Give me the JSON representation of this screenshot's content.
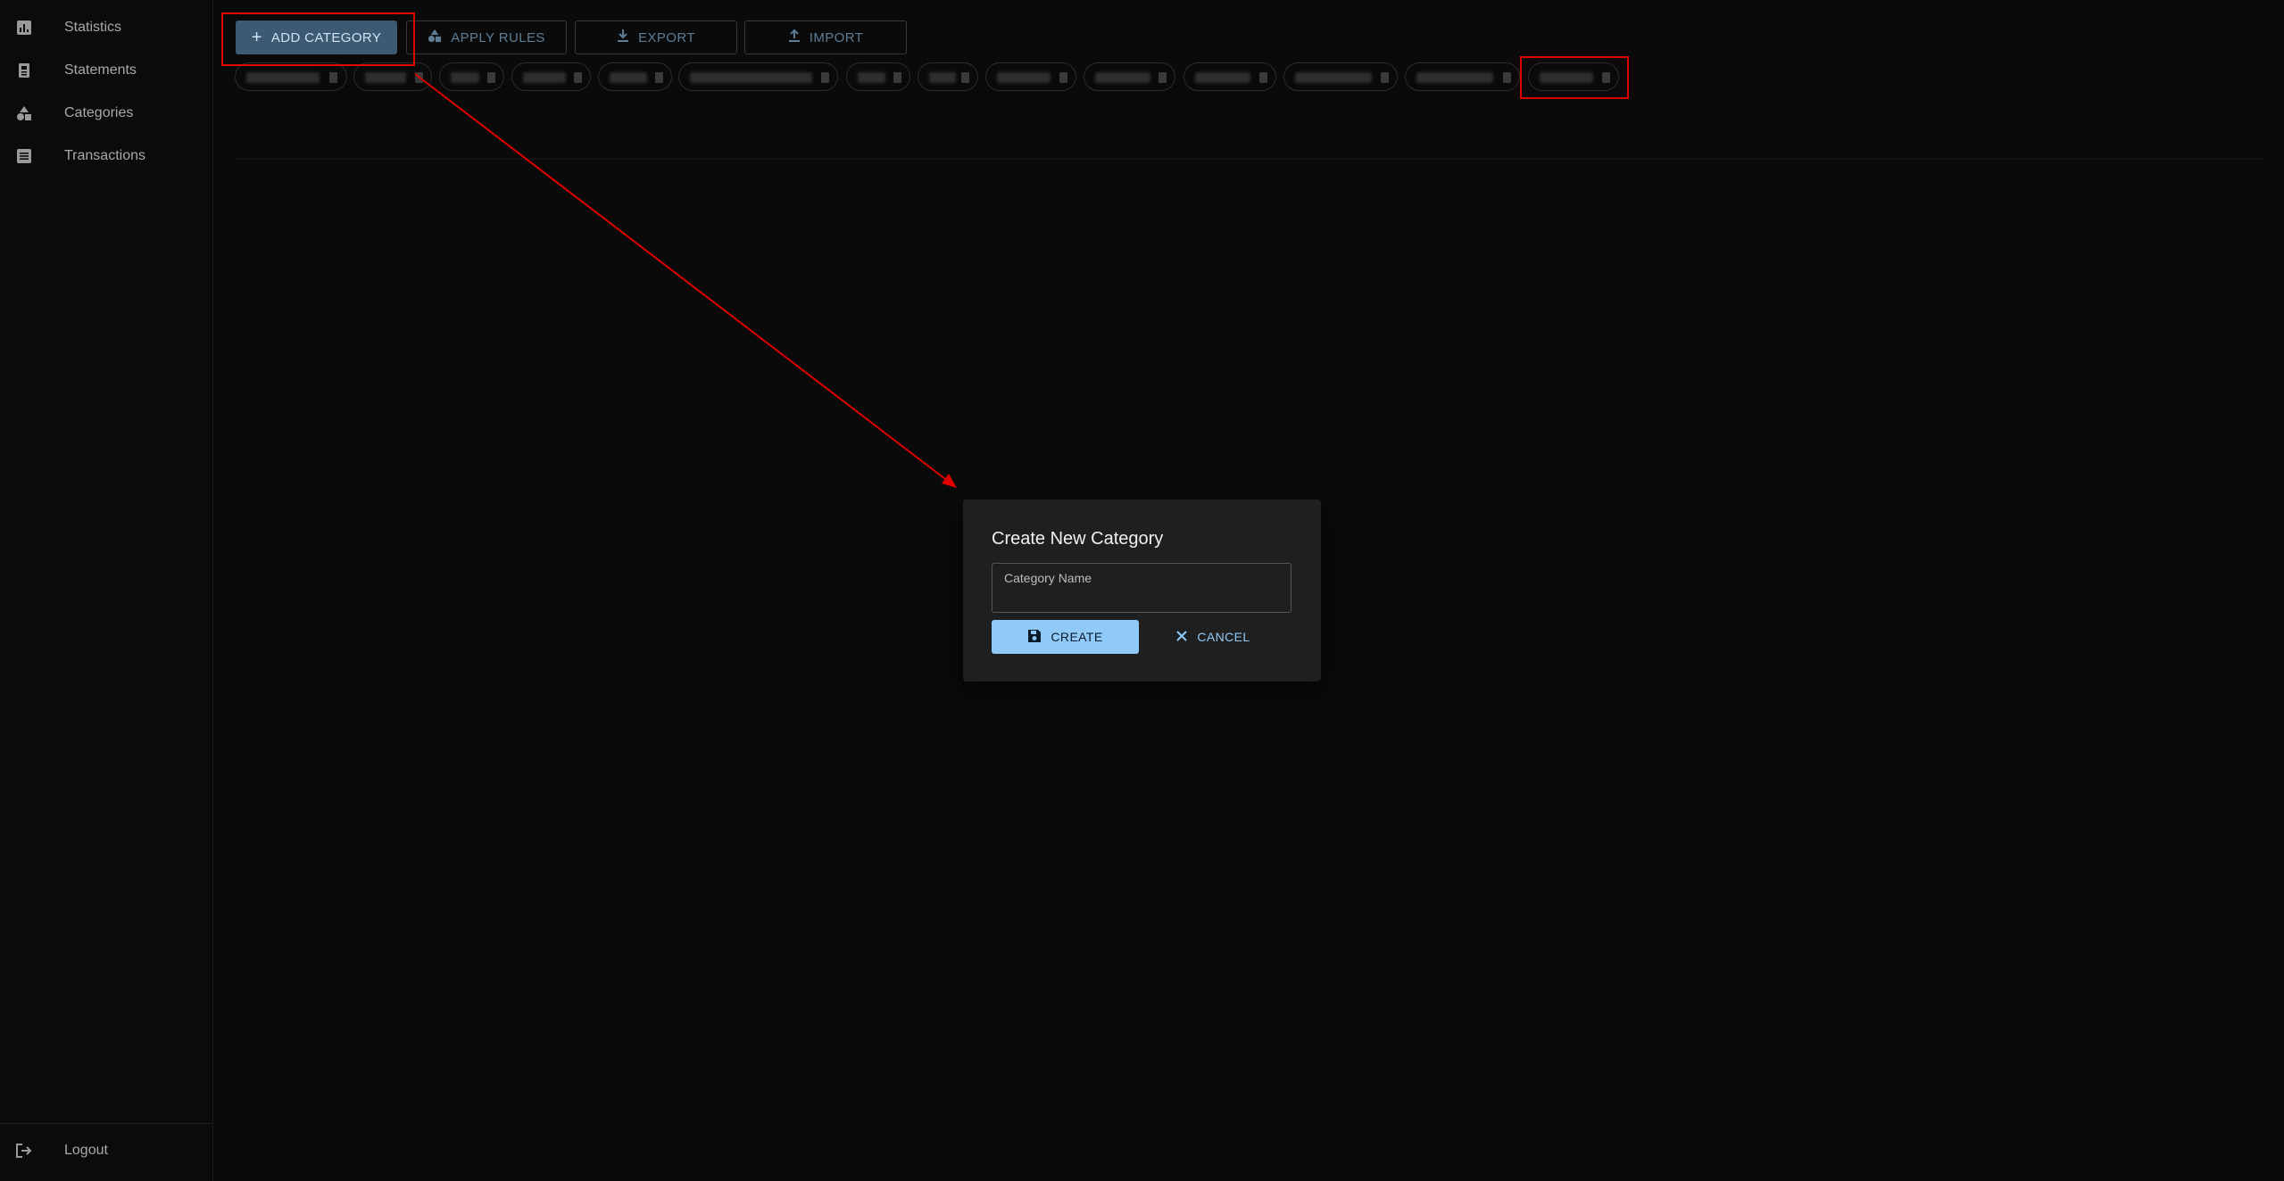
{
  "sidebar": {
    "items": [
      {
        "label": "Statistics",
        "icon": "statistics-icon"
      },
      {
        "label": "Statements",
        "icon": "statements-icon"
      },
      {
        "label": "Categories",
        "icon": "categories-icon"
      },
      {
        "label": "Transactions",
        "icon": "transactions-icon"
      }
    ],
    "logout_label": "Logout"
  },
  "toolbar": {
    "add_category": "ADD CATEGORY",
    "apply_rules": "APPLY RULES",
    "export": "EXPORT",
    "import": "IMPORT"
  },
  "dialog": {
    "title": "Create New Category",
    "field_label": "Category Name",
    "field_value": "",
    "create_label": "CREATE",
    "cancel_label": "CANCEL"
  },
  "colors": {
    "background": "#0a0a0a",
    "primary": "#90caf9",
    "annotation": "#e10000"
  }
}
